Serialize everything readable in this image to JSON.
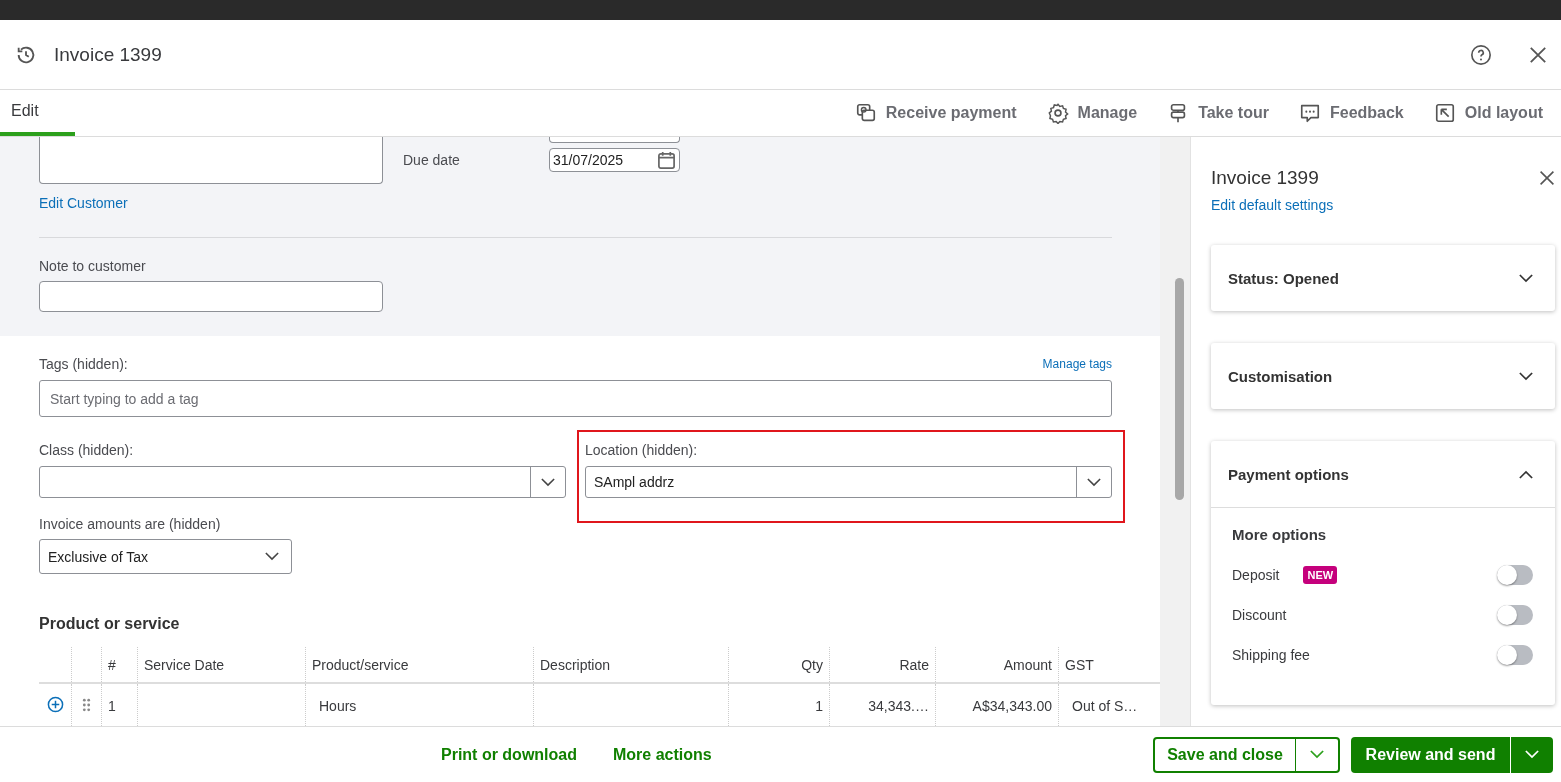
{
  "header": {
    "title": "Invoice 1399"
  },
  "tabs": [
    {
      "label": "Edit",
      "selected": true
    }
  ],
  "toolbar": [
    {
      "label": "Receive payment",
      "kind": "receive"
    },
    {
      "label": "Manage",
      "kind": "gear"
    },
    {
      "label": "Take tour",
      "kind": "signpost"
    },
    {
      "label": "Feedback",
      "kind": "chat"
    },
    {
      "label": "Old layout",
      "kind": "arrow"
    }
  ],
  "customer": {
    "edit_link": "Edit Customer",
    "due_date_label": "Due date",
    "due_date": "31/07/2025",
    "note_label": "Note to customer"
  },
  "tags": {
    "label": "Tags (hidden):",
    "manage_link": "Manage tags",
    "placeholder": "Start typing to add a tag"
  },
  "class_field": {
    "label": "Class (hidden):"
  },
  "location_field": {
    "label": "Location (hidden):",
    "value": "SAmpl addrz",
    "highlighted": true
  },
  "amounts": {
    "label": "Invoice amounts are (hidden)",
    "value": "Exclusive of Tax"
  },
  "products": {
    "title": "Product or service",
    "columns": [
      "#",
      "Service Date",
      "Product/service",
      "Description",
      "Qty",
      "Rate",
      "Amount",
      "GST"
    ],
    "rows": [
      {
        "num": "1",
        "product": "Hours",
        "qty": "1",
        "rate": "34,343.…",
        "amount": "A$34,343.00",
        "gst": "Out of S…"
      }
    ]
  },
  "panel": {
    "title": "Invoice 1399",
    "link": "Edit default settings",
    "sections": [
      {
        "title": "Status: Opened",
        "expanded": false
      },
      {
        "title": "Customisation",
        "expanded": false
      },
      {
        "title": "Payment options",
        "expanded": true,
        "subtitle": "More options",
        "options": [
          {
            "label": "Deposit",
            "badge": "NEW",
            "on": false
          },
          {
            "label": "Discount",
            "on": false
          },
          {
            "label": "Shipping fee",
            "on": false
          }
        ]
      }
    ]
  },
  "footer": {
    "links": [
      "Print or download",
      "More actions"
    ],
    "save": "Save and close",
    "send": "Review and send"
  }
}
